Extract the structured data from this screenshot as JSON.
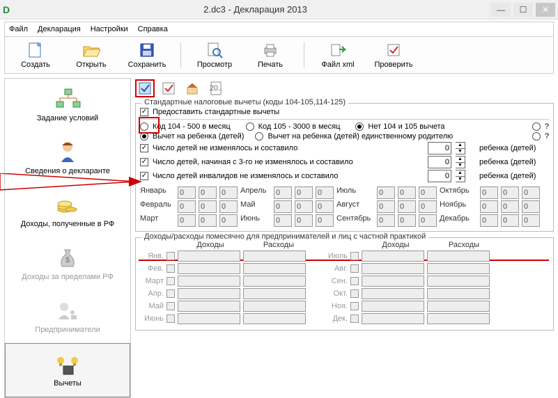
{
  "window": {
    "title": "2.dc3 - Декларация 2013"
  },
  "menu": {
    "file": "Файл",
    "decl": "Декларация",
    "settings": "Настройки",
    "help": "Справка"
  },
  "toolbar": {
    "create": "Создать",
    "open": "Открыть",
    "save": "Сохранить",
    "preview": "Просмотр",
    "print": "Печать",
    "xml": "Файл xml",
    "check": "Проверить"
  },
  "nav": {
    "cond": "Задание условий",
    "declarant": "Сведения о декларанте",
    "income_rf": "Доходы, полученные в РФ",
    "income_abroad": "Доходы за пределами РФ",
    "entrepreneur": "Предприниматели",
    "deductions": "Вычеты"
  },
  "std": {
    "legend": "Стандартные налоговые вычеты (коды 104-105,114-125)",
    "provide": "Предоставить стандартные вычеты",
    "r104": "Код 104 - 500 в месяц",
    "r105": "Код 105 - 3000 в месяц",
    "rnone": "Нет 104 и 105 вычета",
    "rq": "?",
    "child_opt1": "Вычет на ребенка (детей)",
    "child_opt2": "Вычет на ребенка (детей) единственному родителю",
    "child_opt3": "?",
    "c1": "Число детей не изменялось и составило",
    "c2": "Число детей, начиная с 3-го не изменялось и составило",
    "c3": "Число детей инвалидов не изменялось и составило",
    "suffix": "ребенка (детей)",
    "val1": "0",
    "val2": "0",
    "val3": "0",
    "months": [
      "Январь",
      "Февраль",
      "Март",
      "Апрель",
      "Май",
      "Июнь",
      "Июль",
      "Август",
      "Сентябрь",
      "Октябрь",
      "Ноябрь",
      "Декабрь"
    ],
    "mvals": "0"
  },
  "pp": {
    "legend": "Доходы/расходы помесячно для предпринимателей и лиц с частной практикой",
    "income": "Доходы",
    "expense": "Расходы",
    "mon": [
      "Янв.",
      "Фев.",
      "Март",
      "Апр.",
      "Май",
      "Июнь",
      "Июль",
      "Авг.",
      "Сен.",
      "Окт.",
      "Ноя.",
      "Дек."
    ]
  }
}
